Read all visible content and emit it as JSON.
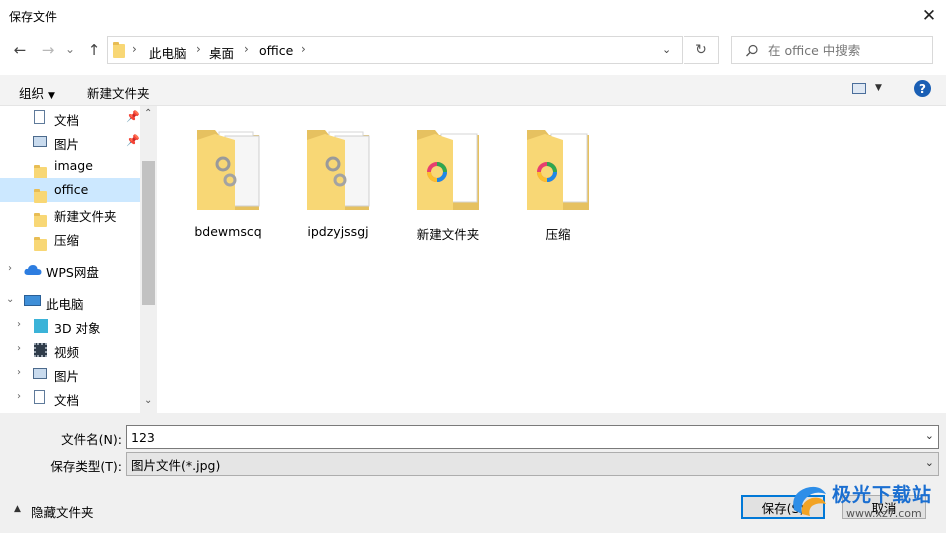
{
  "window": {
    "title": "保存文件",
    "close_glyph": "✕"
  },
  "nav": {
    "back_glyph": "←",
    "forward_glyph": "→",
    "recent_glyph": "⌄",
    "up_glyph": "↑",
    "breadcrumb": [
      "此电脑",
      "桌面",
      "office"
    ],
    "refresh_glyph": "↻",
    "search_placeholder": "在 office 中搜索"
  },
  "toolbar": {
    "organize": "组织",
    "new_folder": "新建文件夹",
    "help": "?"
  },
  "sidebar": {
    "quick_items": [
      {
        "label": "文档",
        "icon": "document-icon",
        "pinned": true
      },
      {
        "label": "图片",
        "icon": "picture-icon",
        "pinned": true
      },
      {
        "label": "image",
        "icon": "folder-icon",
        "pinned": false
      },
      {
        "label": "office",
        "icon": "folder-icon",
        "pinned": false,
        "selected": true
      },
      {
        "label": "新建文件夹",
        "icon": "folder-icon",
        "pinned": false
      },
      {
        "label": "压缩",
        "icon": "folder-icon",
        "pinned": false
      }
    ],
    "wps": "WPS网盘",
    "this_pc": "此电脑",
    "pc_items": [
      {
        "label": "3D 对象",
        "icon": "3d-objects-icon"
      },
      {
        "label": "视频",
        "icon": "video-icon"
      },
      {
        "label": "图片",
        "icon": "picture-icon"
      },
      {
        "label": "文档",
        "icon": "document-icon"
      }
    ]
  },
  "files": [
    {
      "name": "bdewmscq",
      "icon": "folder-gear-icon"
    },
    {
      "name": "ipdzyjssgj",
      "icon": "folder-gear-icon"
    },
    {
      "name": "新建文件夹",
      "icon": "folder-color-icon"
    },
    {
      "name": "压缩",
      "icon": "folder-color-icon"
    }
  ],
  "form": {
    "filename_label": "文件名(N):",
    "filename_value": "123",
    "filetype_label": "保存类型(T):",
    "filetype_value": "图片文件(*.jpg)"
  },
  "footer": {
    "hide_folders": "隐藏文件夹",
    "save": "保存(S)",
    "cancel": "取消"
  },
  "watermark": {
    "text": "极光下载站",
    "url": "www.xz7.com"
  },
  "colors": {
    "selection": "#cce8ff",
    "accent": "#0078d7",
    "folder": "#f8d775"
  }
}
